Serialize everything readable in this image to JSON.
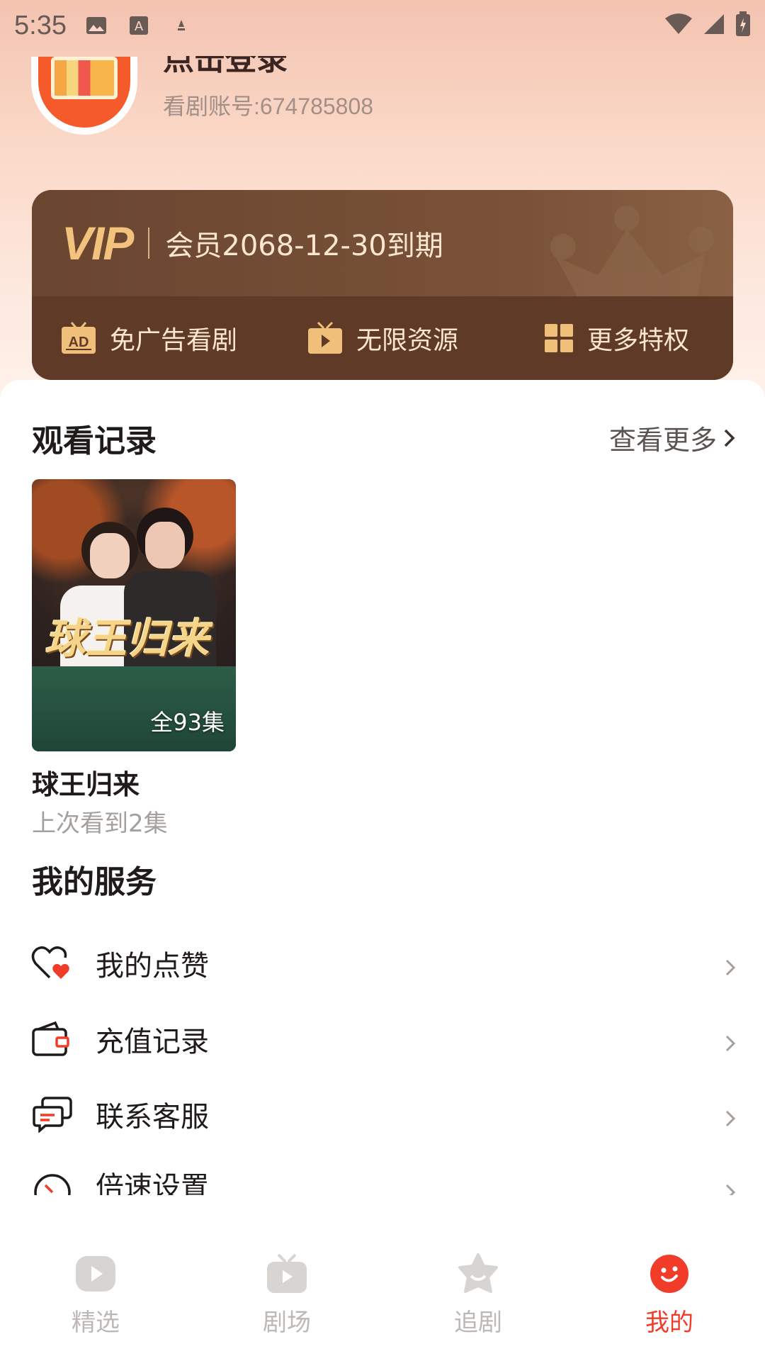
{
  "status_bar": {
    "time": "5:35"
  },
  "profile": {
    "name": "点击登录",
    "account": "看剧账号:674785808"
  },
  "vip": {
    "logo": "VIP",
    "expire_text": "会员2068-12-30到期",
    "perks": [
      {
        "label": "免广告看剧",
        "icon": "ad-icon"
      },
      {
        "label": "无限资源",
        "icon": "tv-icon"
      },
      {
        "label": "更多特权",
        "icon": "grid-icon"
      }
    ]
  },
  "history": {
    "title": "观看记录",
    "more_label": "查看更多",
    "items": [
      {
        "poster_title": "球王归来",
        "episodes": "全93集",
        "name": "球王归来",
        "progress": "上次看到2集"
      }
    ]
  },
  "services": {
    "title": "我的服务",
    "items": [
      {
        "label": "我的点赞",
        "icon": "heart-icon"
      },
      {
        "label": "充值记录",
        "icon": "wallet-icon"
      },
      {
        "label": "联系客服",
        "icon": "chat-icon"
      },
      {
        "label": "倍速设置",
        "icon": "speed-icon"
      }
    ]
  },
  "nav": {
    "items": [
      {
        "label": "精选",
        "icon": "play-icon",
        "active": false
      },
      {
        "label": "剧场",
        "icon": "theater-icon",
        "active": false
      },
      {
        "label": "追剧",
        "icon": "star-icon",
        "active": false
      },
      {
        "label": "我的",
        "icon": "smile-icon",
        "active": true
      }
    ]
  },
  "colors": {
    "accent": "#f23c2a",
    "vip_gold": "#f3c27d",
    "vip_bg": "#6e4a32"
  }
}
